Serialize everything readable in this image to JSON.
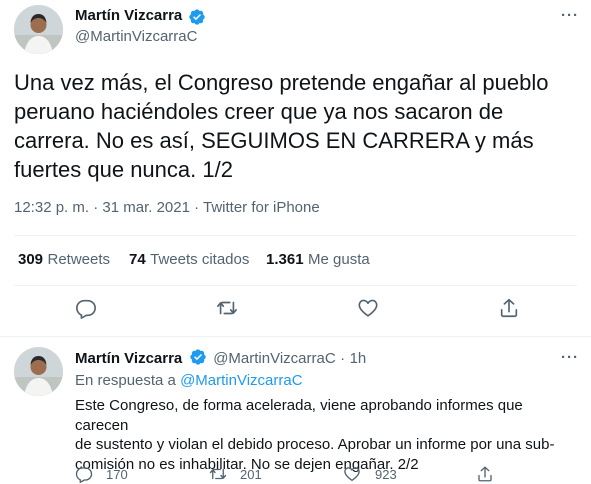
{
  "main_tweet": {
    "author_name": "Martín Vizcarra",
    "author_handle": "@MartinVizcarraC",
    "text_lines": [
      "Una vez más, el Congreso pretende engañar al pueblo",
      "peruano haciéndoles creer que ya nos sacaron de",
      "carrera. No es así, SEGUIMOS EN CARRERA y más",
      "fuertes que nunca.  1/2"
    ],
    "timestamp": "12:32 p. m. · 31 mar. 2021 · Twitter for iPhone",
    "stats": {
      "retweets_count": "309",
      "retweets_label": "Retweets",
      "quotes_count": "74",
      "quotes_label": "Tweets citados",
      "likes_count": "1.361",
      "likes_label": "Me gusta"
    },
    "more_label": "···"
  },
  "reply_tweet": {
    "author_name": "Martín Vizcarra",
    "author_handle": "@MartinVizcarraC",
    "time_sep": "·",
    "time": "1h",
    "replying_prefix": "En respuesta a",
    "replying_handle": "@MartinVizcarraC",
    "text_lines": [
      "Este Congreso, de forma acelerada, viene aprobando informes que carecen",
      "de sustento y violan el debido proceso. Aprobar un informe por una sub-",
      "comisión no es inhabilitar. No se dejen engañar. 2/2"
    ],
    "reply_count": "170",
    "retweet_count": "201",
    "like_count": "923",
    "more_label": "···"
  },
  "colors": {
    "accent": "#1d9bf0",
    "text": "#0f1419",
    "secondary": "#536471",
    "divider": "#eff3f4"
  },
  "icons": [
    "verified-badge-icon",
    "more-icon",
    "reply-icon",
    "retweet-icon",
    "like-icon",
    "share-icon"
  ]
}
